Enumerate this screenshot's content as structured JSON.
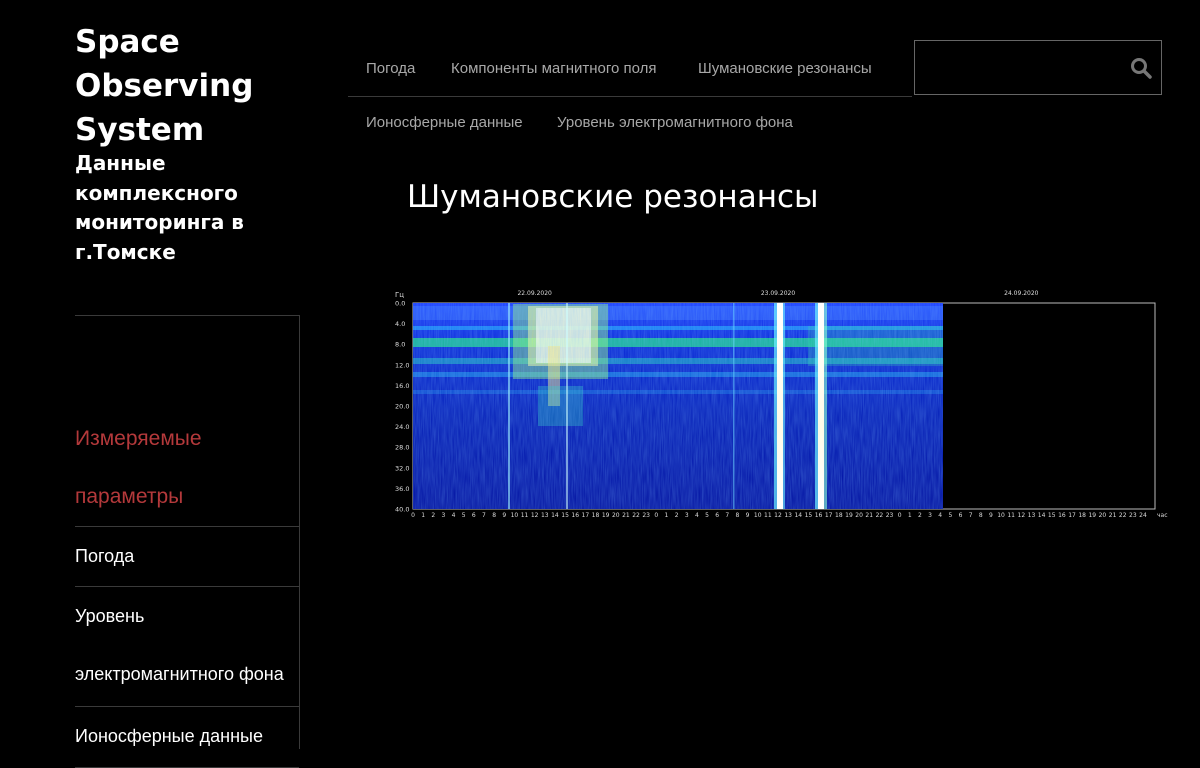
{
  "site": {
    "title_lines": [
      "Space",
      "Observing",
      "System"
    ],
    "tagline_lines": [
      "Данные",
      "комплексного",
      "мониторинга в",
      "г.Томске"
    ]
  },
  "sidebar": {
    "heading_lines": [
      "Измеряемые",
      "параметры"
    ],
    "items": [
      {
        "lines": [
          "Погода"
        ]
      },
      {
        "lines": [
          "Уровень",
          "электромагнитного фона"
        ]
      },
      {
        "lines": [
          "Ионосферные данные"
        ]
      }
    ]
  },
  "nav": {
    "items": [
      {
        "label": "Погода"
      },
      {
        "label": "Компоненты магнитного поля"
      },
      {
        "label": "Шумановские резонансы"
      },
      {
        "label": "Ионосферные данные"
      },
      {
        "label": "Уровень электромагнитного фона"
      }
    ]
  },
  "search": {
    "placeholder": "",
    "icon": "search-icon"
  },
  "main": {
    "title": "Шумановские резонансы"
  },
  "spectrogram": {
    "y_unit": "Гц",
    "x_unit": "час",
    "y_ticks": [
      "0.0",
      "4.0",
      "8.0",
      "12.0",
      "16.0",
      "20.0",
      "24.0",
      "28.0",
      "32.0",
      "36.0",
      "40.0"
    ],
    "dates": [
      "22.09.2020",
      "23.09.2020",
      "24.09.2020"
    ],
    "hour_ticks": [
      "0",
      "1",
      "2",
      "3",
      "4",
      "5",
      "6",
      "7",
      "8",
      "9",
      "10",
      "11",
      "12",
      "13",
      "14",
      "15",
      "16",
      "17",
      "18",
      "19",
      "20",
      "21",
      "22",
      "23",
      "24"
    ],
    "data_until_hour": 51.5
  },
  "colors": {
    "accent": "#b4393b",
    "nav_text": "#a8a8a8",
    "divider": "#3a3a3a"
  }
}
